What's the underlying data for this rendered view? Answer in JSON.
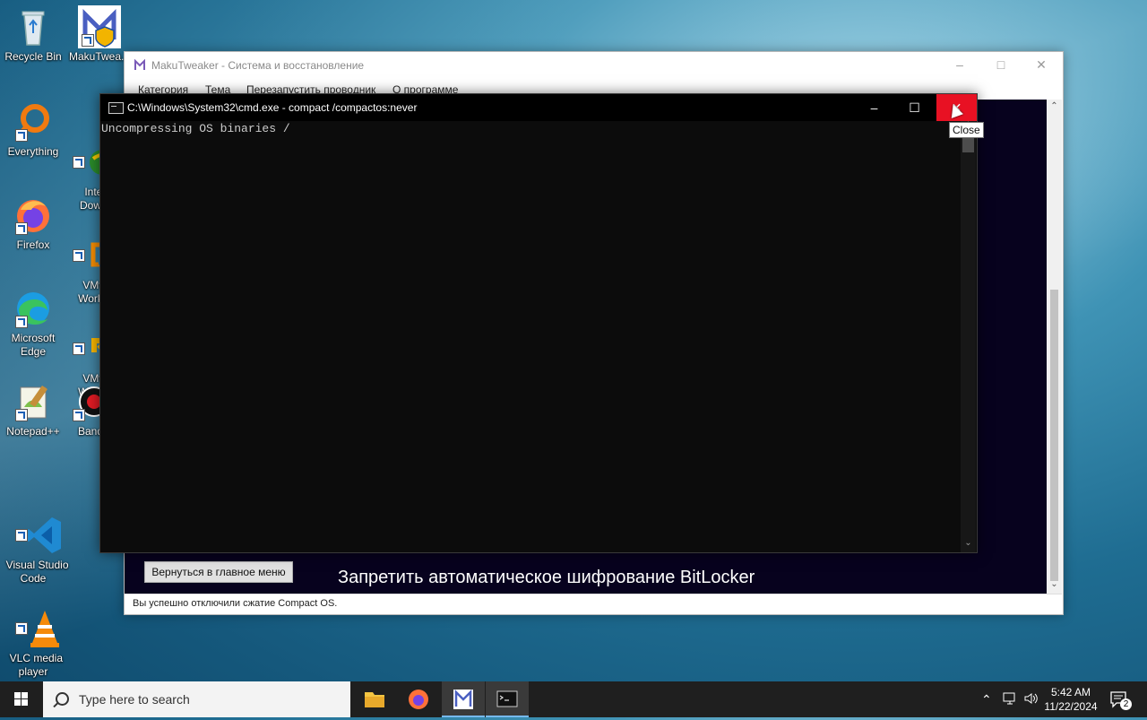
{
  "desktop": {
    "icons": [
      {
        "label": "Recycle Bin"
      },
      {
        "label": "MakuTwea..."
      },
      {
        "label": "Everything"
      },
      {
        "label": "Inte\nDow"
      },
      {
        "label": "Firefox"
      },
      {
        "label": "VMv\nWork"
      },
      {
        "label": "Microsoft\nEdge"
      },
      {
        "label": "VMv\nWork"
      },
      {
        "label": "Notepad++"
      },
      {
        "label": "Band"
      },
      {
        "label": "Visual Studio\nCode"
      },
      {
        "label": "VLC media\nplayer"
      }
    ]
  },
  "maku": {
    "title": "MakuTweaker - Система и восстановление",
    "menu": [
      "Категория",
      "Тема",
      "Перезапустить проводник",
      "О программе"
    ],
    "back_button": "Вернуться в главное меню",
    "bitlocker_label": "Запретить автоматическое шифрование BitLocker",
    "status": "Вы успешно отключили сжатие Compact OS."
  },
  "cmd": {
    "title": "C:\\Windows\\System32\\cmd.exe - compact  /compactos:never",
    "output": "Uncompressing OS binaries /",
    "close_tooltip": "Close"
  },
  "taskbar": {
    "search_placeholder": "Type here to search",
    "time": "5:42 AM",
    "date": "11/22/2024",
    "notification_count": "2"
  },
  "colors": {
    "close_red": "#e81123",
    "maku_dark_bg": "#07021e",
    "taskbar": "#1f1f1f"
  }
}
